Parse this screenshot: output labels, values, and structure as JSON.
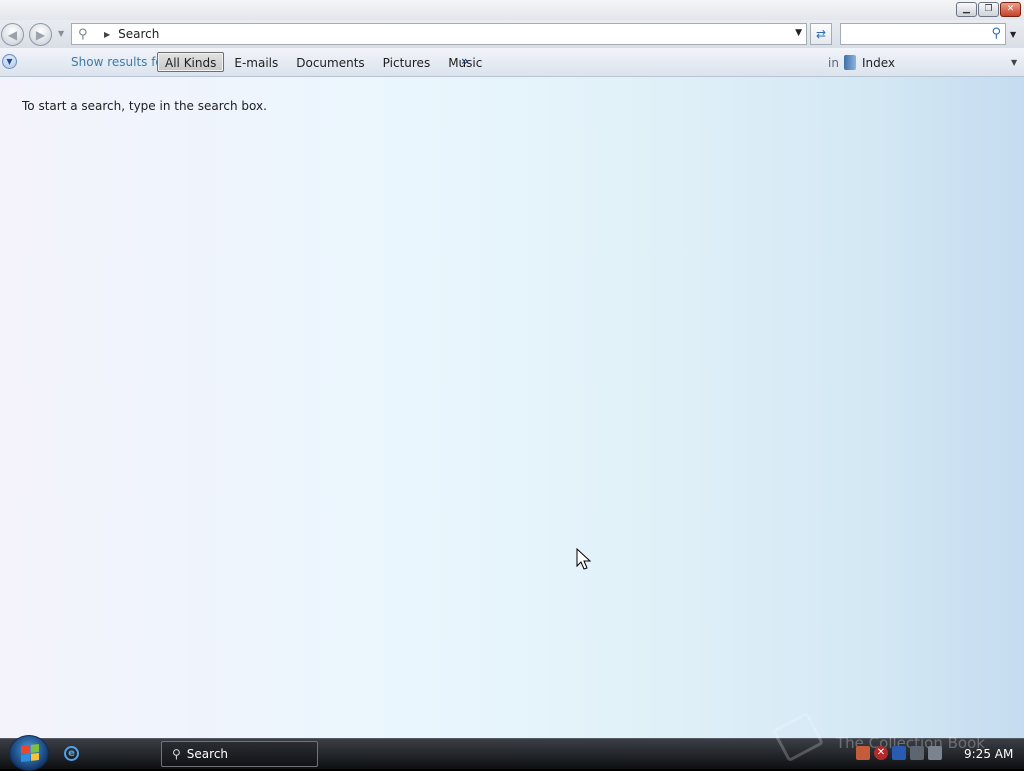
{
  "window": {
    "address": {
      "location": "Search"
    },
    "search": {
      "value": "",
      "placeholder": ""
    },
    "filter_bar": {
      "show_results_label": "Show results for",
      "kinds": [
        {
          "label": "All Kinds",
          "selected": true
        },
        {
          "label": "E-mails",
          "selected": false
        },
        {
          "label": "Documents",
          "selected": false
        },
        {
          "label": "Pictures",
          "selected": false
        },
        {
          "label": "Music",
          "selected": false
        }
      ],
      "more_glyph": "»",
      "in_label": "in",
      "scope": "Index"
    },
    "content": {
      "hint": "To start a search, type in the search box."
    }
  },
  "taskbar": {
    "task_button_label": "Search",
    "watermark": "The Collection Book",
    "clock": "9:25 AM"
  },
  "icons": {
    "back": "back-arrow-icon",
    "forward": "forward-arrow-icon",
    "search": "magnifier-icon",
    "refresh": "refresh-icon",
    "index": "index-book-icon",
    "start": "windows-logo-icon",
    "ie": "internet-explorer-icon"
  },
  "colors": {
    "accent": "#3c7ca6",
    "taskbar": "#1a1c20",
    "content_left": "#f4f3fc",
    "content_right": "#c5dcf0"
  }
}
